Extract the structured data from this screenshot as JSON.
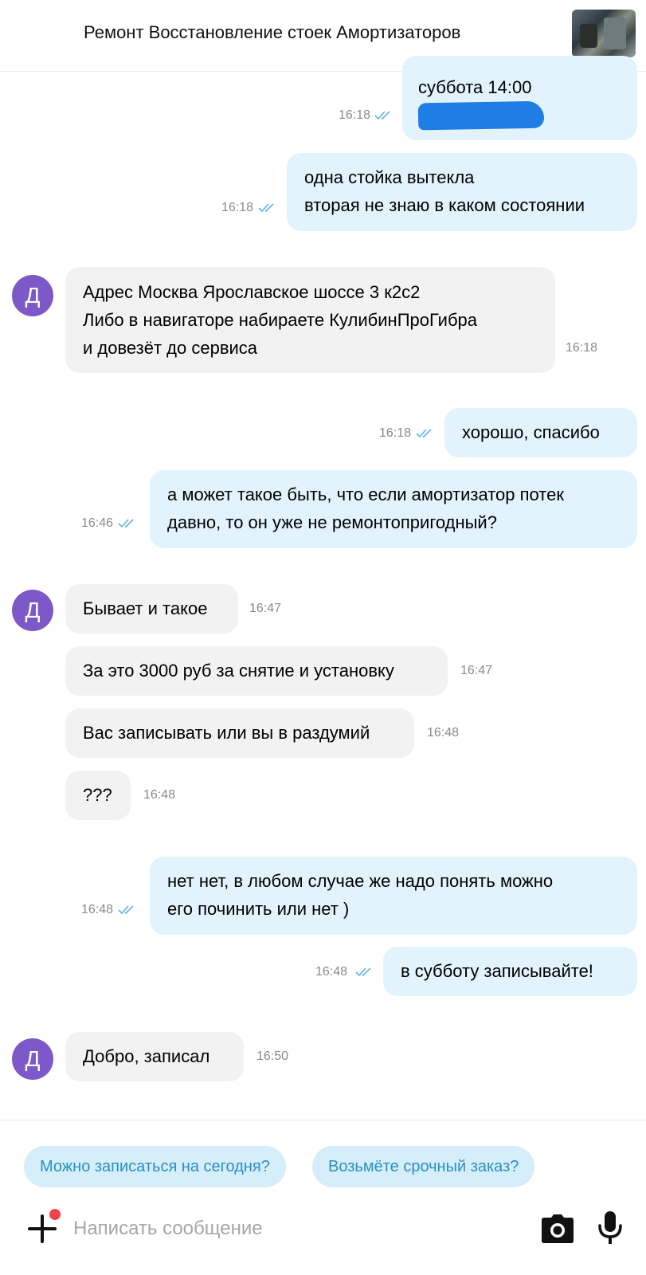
{
  "header": {
    "title": "Ремонт Восстановление стоек Амортизаторов"
  },
  "avatar_letter": "Д",
  "messages": [
    {
      "dir": "out",
      "lines": [
        "суббота 14:00"
      ],
      "time": "16:18",
      "read": true
    },
    {
      "dir": "out",
      "lines": [
        "одна стойка вытекла",
        "вторая не знаю в каком состоянии"
      ],
      "time": "16:18",
      "read": true
    },
    {
      "dir": "in",
      "lines": [
        "Адрес Москва Ярославское шоссе 3 к2с2",
        "Либо в навигаторе набираете КулибинПроГибра",
        "и довезёт до сервиса"
      ],
      "time": "16:18"
    },
    {
      "dir": "out",
      "lines": [
        "хорошо, спасибо"
      ],
      "time": "16:18",
      "read": true
    },
    {
      "dir": "out",
      "lines": [
        "а может такое быть, что если амортизатор потек",
        "давно, то он уже не ремонтопригодный?"
      ],
      "time": "16:46",
      "read": true
    },
    {
      "dir": "in",
      "lines": [
        "Бывает и такое"
      ],
      "time": "16:47"
    },
    {
      "dir": "in",
      "lines": [
        "За это 3000 руб за снятие и установку"
      ],
      "time": "16:47"
    },
    {
      "dir": "in",
      "lines": [
        "Вас записывать или вы в раздумий"
      ],
      "time": "16:48"
    },
    {
      "dir": "in",
      "lines": [
        "???"
      ],
      "time": "16:48"
    },
    {
      "dir": "out",
      "lines": [
        "нет нет, в любом случае же надо понять можно",
        "его починить или нет )"
      ],
      "time": "16:48",
      "read": true
    },
    {
      "dir": "out",
      "lines": [
        "в субботу записывайте!"
      ],
      "time": "16:48",
      "read": true
    },
    {
      "dir": "in",
      "lines": [
        "Добро, записал"
      ],
      "time": "16:50"
    }
  ],
  "quick_replies": [
    "Можно записаться на сегодня?",
    "Возьмёте срочный заказ?"
  ],
  "composer": {
    "placeholder": "Написать сообщение"
  },
  "icons": {
    "attach": "plus-icon",
    "camera": "camera-icon",
    "mic": "microphone-icon",
    "read_status": "double-check-icon"
  },
  "colors": {
    "outgoing_bubble": "#e2f3fd",
    "incoming_bubble": "#f2f2f2",
    "avatar": "#7d58c8",
    "chip_bg": "#d6eef9",
    "chip_text": "#2b8fc4",
    "ticks": "#5bb6e6",
    "notification_dot": "#f0434c"
  }
}
